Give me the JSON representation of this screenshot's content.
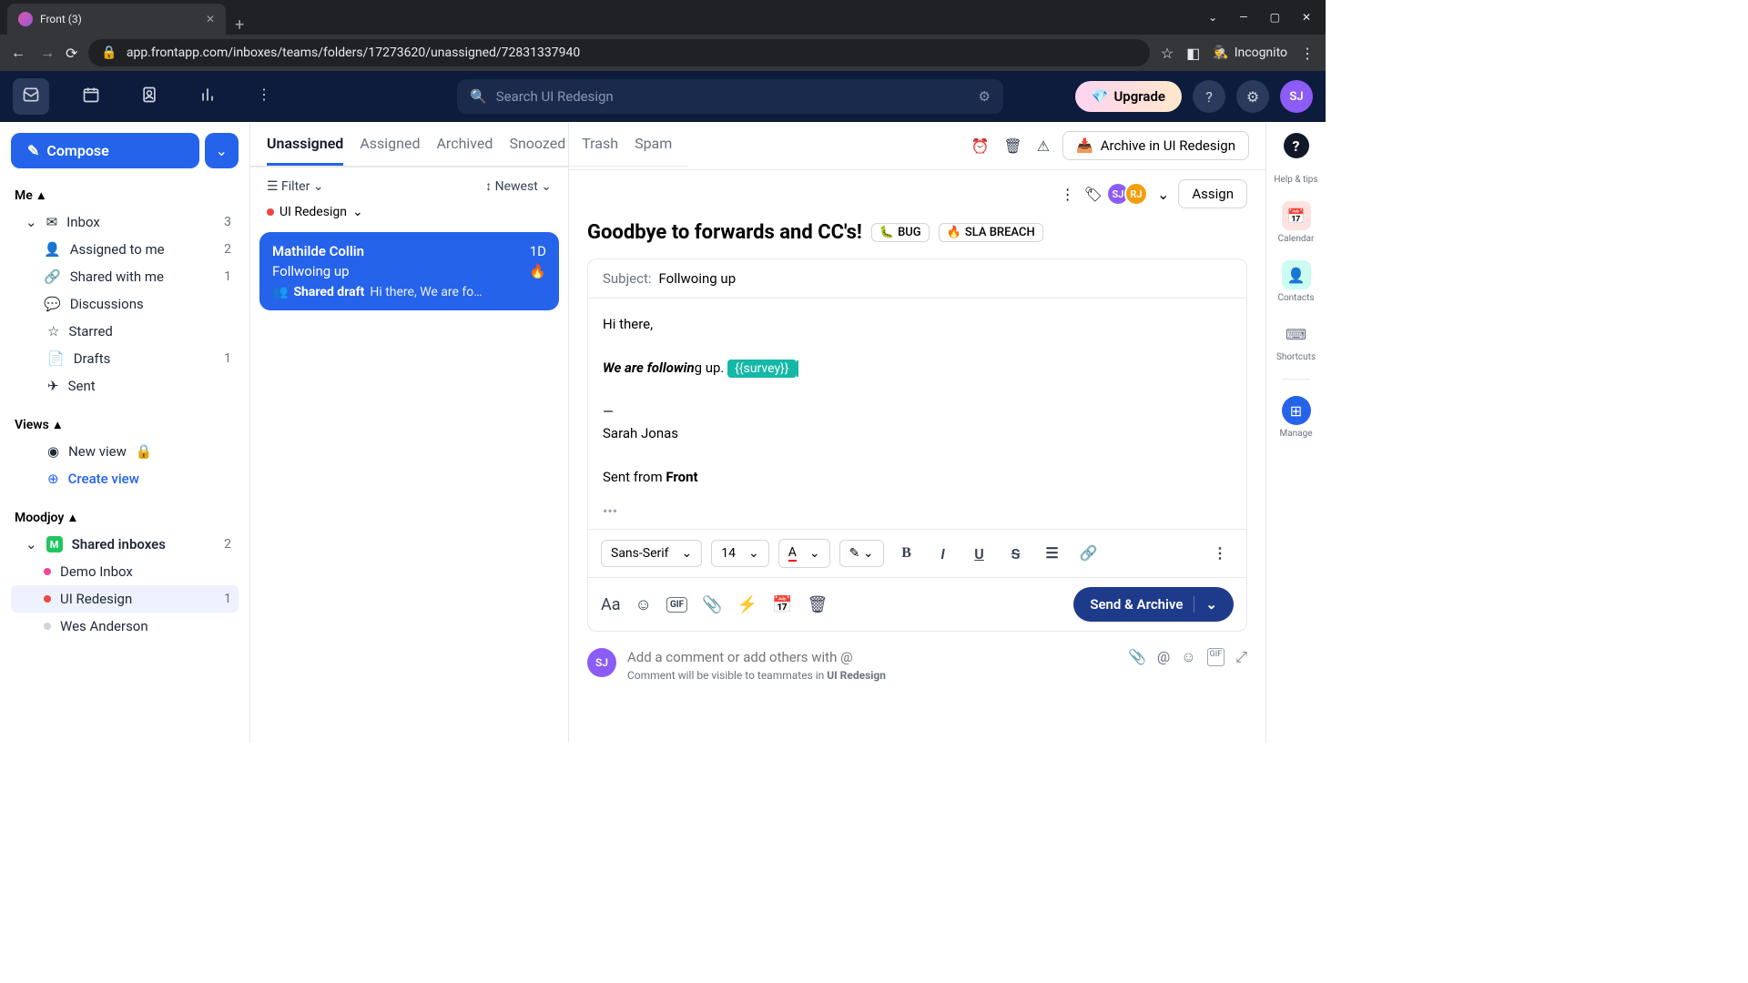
{
  "browser": {
    "tab_title": "Front (3)",
    "url": "app.frontapp.com/inboxes/teams/folders/17273620/unassigned/72831337940",
    "incognito": "Incognito"
  },
  "topbar": {
    "search_placeholder": "Search UI Redesign",
    "upgrade": "Upgrade",
    "avatar_initials": "SJ"
  },
  "sidebar": {
    "compose": "Compose",
    "sections": {
      "me": "Me",
      "views": "Views",
      "moodjoy": "Moodjoy"
    },
    "inbox": {
      "label": "Inbox",
      "count": "3"
    },
    "assigned_to_me": {
      "label": "Assigned to me",
      "count": "2"
    },
    "shared_with_me": {
      "label": "Shared with me",
      "count": "1"
    },
    "discussions": {
      "label": "Discussions"
    },
    "starred": {
      "label": "Starred"
    },
    "drafts": {
      "label": "Drafts",
      "count": "1"
    },
    "sent": {
      "label": "Sent"
    },
    "new_view": {
      "label": "New view"
    },
    "create_view": {
      "label": "Create view"
    },
    "shared_inboxes": {
      "label": "Shared inboxes",
      "count": "2"
    },
    "demo_inbox": {
      "label": "Demo Inbox"
    },
    "ui_redesign": {
      "label": "UI Redesign",
      "count": "1"
    },
    "wes_anderson": {
      "label": "Wes Anderson"
    }
  },
  "tabs": {
    "unassigned": "Unassigned",
    "assigned": "Assigned",
    "archived": "Archived",
    "snoozed": "Snoozed",
    "trash": "Trash",
    "spam": "Spam"
  },
  "filters": {
    "filter": "Filter",
    "sort": "Newest",
    "channel": "UI Redesign"
  },
  "conversation": {
    "sender": "Mathilde Collin",
    "time": "1D",
    "subject": "Follwoing up",
    "fire": "🔥",
    "draft_label": "Shared draft",
    "preview": "Hi there, We are fo…"
  },
  "content": {
    "archive_in": "Archive in UI Redesign",
    "assign": "Assign",
    "thread_title": "Goodbye to forwards and CC's!",
    "tag_bug": "BUG",
    "tag_sla": "SLA BREACH",
    "subject_label": "Subject:",
    "subject_value": "Follwoing up",
    "greeting": "Hi there,",
    "body_bold": "We are followin",
    "body_rest": "g up.",
    "survey_tag": "{{survey}}",
    "divider": "—",
    "signature": "Sarah Jonas",
    "sent_from": "Sent from ",
    "front": "Front",
    "font_family": "Sans-Serif",
    "font_size": "14",
    "send_button": "Send & Archive"
  },
  "comment": {
    "avatar": "SJ",
    "placeholder": "Add a comment or add others with @",
    "hint_prefix": "Comment will be visible to teammates in ",
    "hint_bold": "UI Redesign"
  },
  "rail": {
    "help_tips": "Help & tips",
    "calendar": "Calendar",
    "contacts": "Contacts",
    "shortcuts": "Shortcuts",
    "manage": "Manage"
  }
}
